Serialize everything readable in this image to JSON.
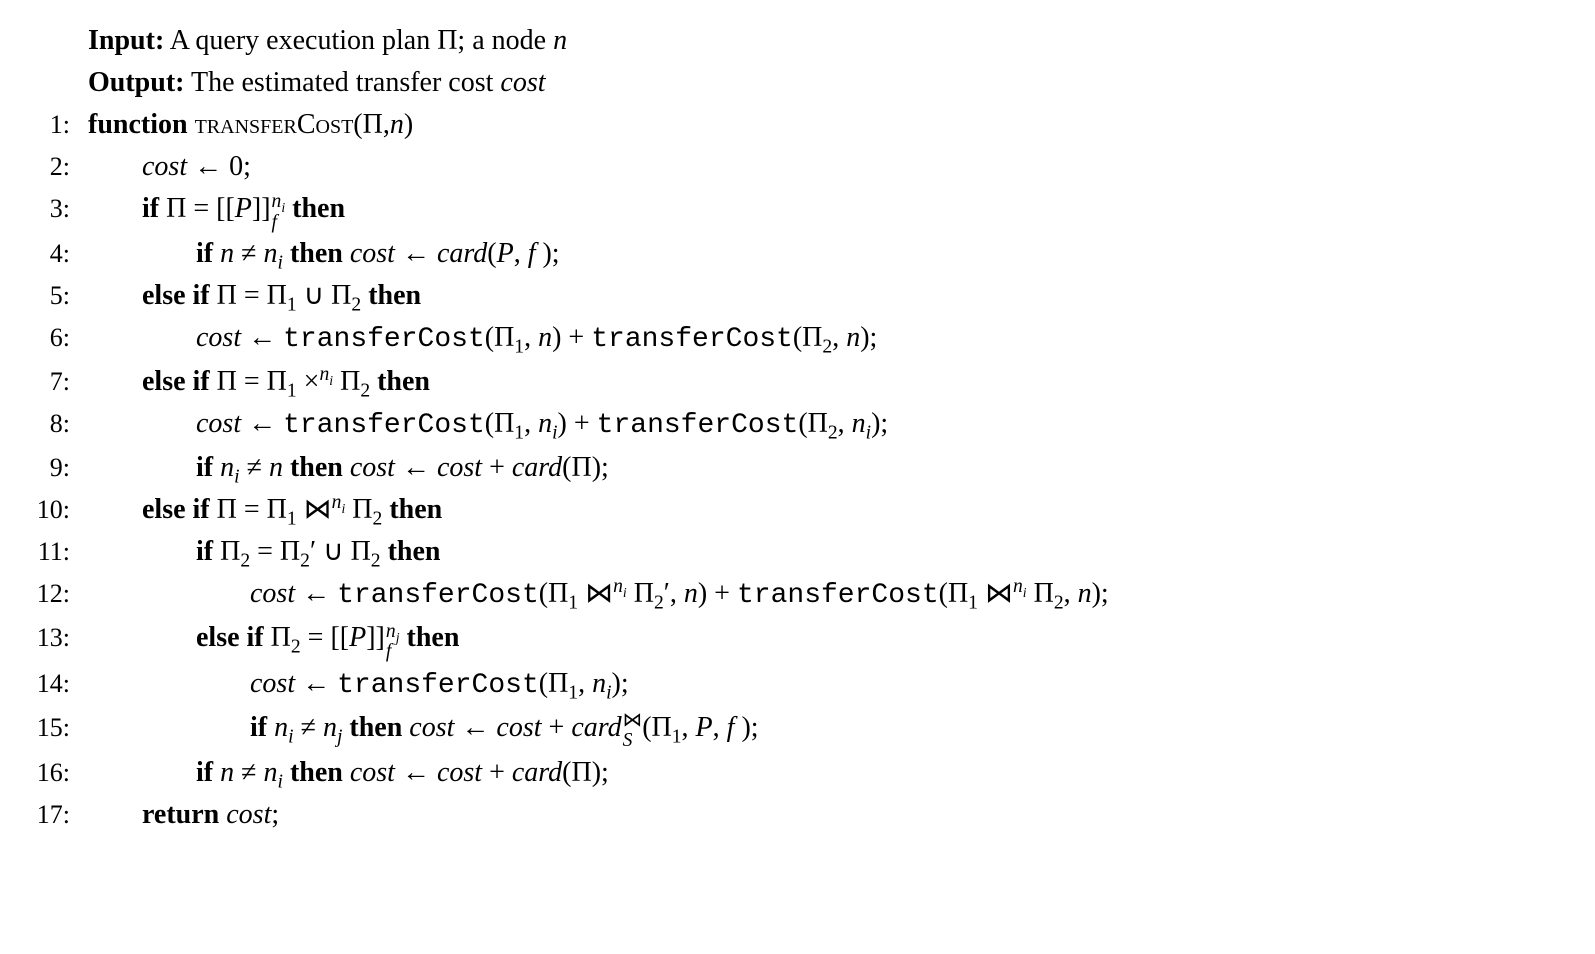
{
  "header": {
    "input_label": "Input:",
    "input_text_html": "A query execution plan Π; a node <span class='ital'>n</span>",
    "output_label": "Output:",
    "output_text_html": "The estimated transfer cost <span class='ital'>cost</span>"
  },
  "lines": [
    {
      "num": "1:",
      "indent": 0,
      "html": "<span class='bold'>function</span> <span class='sc'>transferCost</span>(Π,<span class='ital'>n</span>)"
    },
    {
      "num": "2:",
      "indent": 1,
      "html": "<span class='ital'>cost</span> ← 0;"
    },
    {
      "num": "3:",
      "indent": 1,
      "html": "<span class='bold'>if</span> Π = [[<span class='ital'>P</span>]]<span class='supsub'><span class='sup'><span class='ital'>n<sub>i</sub></span></span><span class='sub'><span class='ital'>f</span></span></span> <span class='bold'>then</span>"
    },
    {
      "num": "4:",
      "indent": 2,
      "html": "<span class='bold'>if</span> <span class='ital'>n</span> ≠ <span class='ital'>n<sub>i</sub></span> <span class='bold'>then</span> <span class='ital'>cost</span> ← <span class='ital'>card</span>(<span class='ital'>P</span>, <span class='ital'>f</span> );"
    },
    {
      "num": "5:",
      "indent": 1,
      "html": "<span class='bold'>else if</span> Π = Π<sub>1</sub> ∪ Π<sub>2</sub> <span class='bold'>then</span>"
    },
    {
      "num": "6:",
      "indent": 2,
      "html": "<span class='ital'>cost</span> ← <span class='tt'>transferCost</span>(Π<sub>1</sub>, <span class='ital'>n</span>) + <span class='tt'>transferCost</span>(Π<sub>2</sub>, <span class='ital'>n</span>);"
    },
    {
      "num": "7:",
      "indent": 1,
      "html": "<span class='bold'>else if</span> Π = Π<sub>1</sub> ×<sup><span class='ital'>n<sub>i</sub></span></sup> Π<sub>2</sub> <span class='bold'>then</span>"
    },
    {
      "num": "8:",
      "indent": 2,
      "html": "<span class='ital'>cost</span> ← <span class='tt'>transferCost</span>(Π<sub>1</sub>, <span class='ital'>n<sub>i</sub></span>) + <span class='tt'>transferCost</span>(Π<sub>2</sub>, <span class='ital'>n<sub>i</sub></span>);"
    },
    {
      "num": "9:",
      "indent": 2,
      "html": "<span class='bold'>if</span> <span class='ital'>n<sub>i</sub></span> ≠ <span class='ital'>n</span> <span class='bold'>then</span> <span class='ital'>cost</span> ← <span class='ital'>cost</span> + <span class='ital'>card</span>(Π);"
    },
    {
      "num": "10:",
      "indent": 1,
      "html": "<span class='bold'>else if</span> Π = Π<sub>1</sub> ⋈<sup><span class='ital'>n<sub>i</sub></span></sup> Π<sub>2</sub> <span class='bold'>then</span>"
    },
    {
      "num": "11:",
      "indent": 2,
      "html": "<span class='bold'>if</span> Π<sub>2</sub> = Π<sub>2</sub>′ ∪ Π<sub>2</sub> <span class='bold'>then</span>"
    },
    {
      "num": "12:",
      "indent": 3,
      "html": "<span class='ital'>cost</span> ← <span class='tt'>transferCost</span>(Π<sub>1</sub> ⋈<sup><span class='ital'>n<sub>i</sub></span></sup> Π<sub>2</sub>′, <span class='ital'>n</span>) + <span class='tt'>transferCost</span>(Π<sub>1</sub> ⋈<sup><span class='ital'>n<sub>i</sub></span></sup> Π<sub>2</sub>, <span class='ital'>n</span>);"
    },
    {
      "num": "13:",
      "indent": 2,
      "html": "<span class='bold'>else if</span> Π<sub>2</sub> = [[<span class='ital'>P</span>]]<span class='supsub'><span class='sup'><span class='ital'>n<sub>j</sub></span></span><span class='sub'><span class='ital'>f</span></span></span> <span class='bold'>then</span>"
    },
    {
      "num": "14:",
      "indent": 3,
      "html": "<span class='ital'>cost</span> ← <span class='tt'>transferCost</span>(Π<sub>1</sub>, <span class='ital'>n<sub>i</sub></span>);"
    },
    {
      "num": "15:",
      "indent": 3,
      "html": "<span class='bold'>if</span> <span class='ital'>n<sub>i</sub></span> ≠ <span class='ital'>n<sub>j</sub></span> <span class='bold'>then</span> <span class='ital'>cost</span> ← <span class='ital'>cost</span> + <span class='ital'>card</span><span class='supsub'><span class='sup'>⋈</span><span class='sub'><span class='ital'>S</span></span></span>(Π<sub>1</sub>, <span class='ital'>P</span>, <span class='ital'>f</span> );"
    },
    {
      "num": "16:",
      "indent": 2,
      "html": "<span class='bold'>if</span> <span class='ital'>n</span> ≠ <span class='ital'>n<sub>i</sub></span> <span class='bold'>then</span> <span class='ital'>cost</span> ← <span class='ital'>cost</span> + <span class='ital'>card</span>(Π);"
    },
    {
      "num": "17:",
      "indent": 1,
      "html": "<span class='bold'>return</span> <span class='ital'>cost</span>;"
    }
  ]
}
